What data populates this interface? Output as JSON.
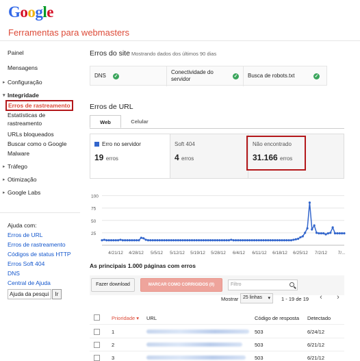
{
  "header": {
    "logo_letters": [
      "G",
      "o",
      "o",
      "g",
      "l",
      "e"
    ],
    "logo_colors": [
      "#3369e8",
      "#d50f25",
      "#eeb211",
      "#3369e8",
      "#009925",
      "#d50f25"
    ],
    "app_title": "Ferramentas para webmasters"
  },
  "sidebar": {
    "items": [
      {
        "label": "Painel"
      },
      {
        "label": "Mensagens"
      },
      {
        "label": "Configuração"
      },
      {
        "label": "Integridade"
      },
      {
        "label": "Erros de rastreamento"
      },
      {
        "label": "Estatísticas de"
      },
      {
        "label": "rastreamento"
      },
      {
        "label": "URLs bloqueados"
      },
      {
        "label": "Buscar como o Google"
      },
      {
        "label": "Malware"
      },
      {
        "label": "Tráfego"
      },
      {
        "label": "Otimização"
      },
      {
        "label": "Google Labs"
      }
    ],
    "help": {
      "title": "Ajuda com:",
      "links": [
        "Erros de URL",
        "Erros de rastreamento",
        "Códigos de status HTTP",
        "Erros Soft 404",
        "DNS",
        "Central de Ajuda"
      ],
      "search_value": "Ajuda da pesqui",
      "search_button": "Ir"
    }
  },
  "site_errors": {
    "title": "Erros do site",
    "subtitle": "Mostrando dados dos últimos 90 dias",
    "checks": [
      {
        "label": "DNS"
      },
      {
        "label": "Conectividade do servidor"
      },
      {
        "label": "Busca de robots.txt"
      }
    ]
  },
  "url_errors": {
    "title": "Erros de URL",
    "tabs": [
      {
        "label": "Web"
      },
      {
        "label": "Celular"
      }
    ],
    "metrics": [
      {
        "label": "Erro no servidor",
        "value": "19",
        "unit": "erros"
      },
      {
        "label": "Soft 404",
        "value": "4",
        "unit": "erros"
      },
      {
        "label": "Não encontrado",
        "value": "31.166",
        "unit": "erros"
      }
    ],
    "accent_color": "#3366cc",
    "highlight_color": "#b3171a"
  },
  "chart_data": {
    "type": "line",
    "yticks": [
      "25",
      "50",
      "75",
      "100"
    ],
    "ylim": [
      0,
      105
    ],
    "xticks": [
      "4/21/12",
      "4/28/12",
      "5/5/12",
      "5/12/12",
      "5/19/12",
      "5/28/12",
      "6/4/12",
      "6/11/12",
      "6/18/12",
      "6/25/12",
      "7/2/12",
      "7/..."
    ],
    "series": [
      {
        "values": [
          10,
          11,
          10,
          10,
          10,
          10,
          10,
          10,
          11,
          10,
          10,
          10,
          10,
          10,
          10,
          10,
          10,
          15,
          14,
          11,
          10,
          10,
          10,
          10,
          10,
          10,
          10,
          10,
          10,
          10,
          10,
          10,
          10,
          10,
          10,
          10,
          10,
          10,
          10,
          10,
          10,
          10,
          10,
          10,
          10,
          10,
          10,
          10,
          10,
          10,
          10,
          10,
          10,
          10,
          10,
          10,
          11,
          10,
          10,
          10,
          10,
          10,
          10,
          10,
          10,
          10,
          10,
          10,
          10,
          10,
          10,
          10,
          10,
          10,
          10,
          10,
          10,
          10,
          10,
          10,
          10,
          10,
          10,
          11,
          12,
          13,
          16,
          18,
          25,
          34,
          86,
          32,
          40,
          25,
          24,
          24,
          24,
          22,
          24,
          25,
          36,
          24,
          24,
          24,
          24,
          24
        ]
      }
    ],
    "grid": true
  },
  "pages": {
    "title": "As principais 1.000 páginas com erros",
    "download": "Fazer download",
    "mark_fixed": "MARCAR COMO CORRIGIDOS (0)",
    "filter_placeholder": "Filtro",
    "show_label": "Mostrar",
    "rows_select": "25 linhas",
    "count": "1 - 19 de 19",
    "columns": [
      "Prioridade",
      "URL",
      "Código de resposta",
      "Detectado"
    ],
    "rows": [
      {
        "priority": "1",
        "code": "503",
        "date": "6/24/12"
      },
      {
        "priority": "2",
        "code": "503",
        "date": "6/21/12"
      },
      {
        "priority": "3",
        "code": "503",
        "date": "6/21/12"
      }
    ]
  }
}
